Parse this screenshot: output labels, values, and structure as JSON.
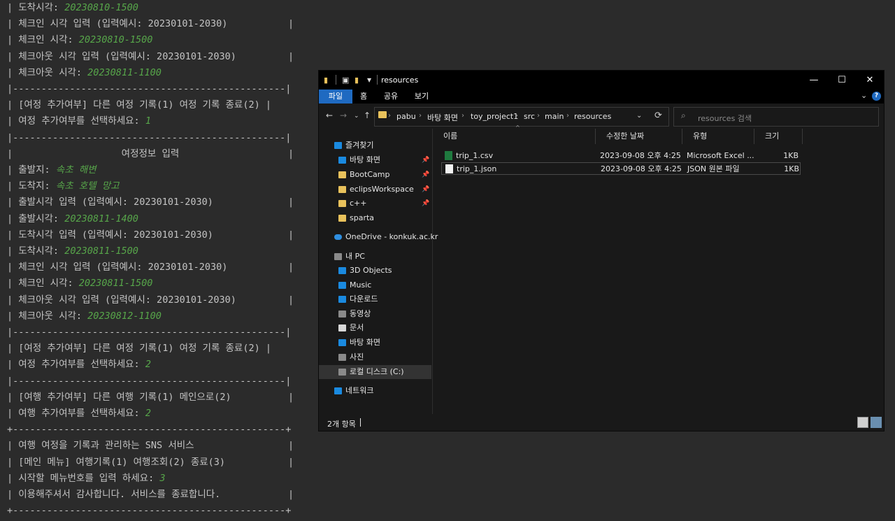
{
  "console": {
    "lines": [
      {
        "text": "| 도착시각: ",
        "input": "20230810-1500",
        "border": false
      },
      {
        "text": "| 체크인 시각 입력 (입력예시: 20230101-2030)",
        "border": true
      },
      {
        "text": "| 체크인 시각: ",
        "input": "20230810-1500",
        "border": false
      },
      {
        "text": "| 체크아웃 시각 입력 (입력예시: 20230101-2030)",
        "border": true
      },
      {
        "text": "| 체크아웃 시각: ",
        "input": "20230811-1100",
        "border": false
      },
      {
        "text": "|------------------------------------------------|",
        "border": false
      },
      {
        "text": "| [여정 추가여부] 다른 여정 기록(1) 여정 기록 종료(2) |",
        "border": false
      },
      {
        "text": "| 여정 추가여부를 선택하세요: ",
        "input": "1",
        "border": false
      },
      {
        "text": "|------------------------------------------------|",
        "border": false
      },
      {
        "text": "|",
        "center": "여정정보 입력",
        "border": true
      },
      {
        "text": "| 출발지: ",
        "input": "속초 해변",
        "border": false
      },
      {
        "text": "| 도착지: ",
        "input": "속초 호텔 망고",
        "border": false
      },
      {
        "text": "| 출발시각 입력 (입력예시: 20230101-2030)",
        "border": true
      },
      {
        "text": "| 출발시각: ",
        "input": "20230811-1400",
        "border": false
      },
      {
        "text": "| 도착시각 입력 (입력예시: 20230101-2030)",
        "border": true
      },
      {
        "text": "| 도착시각: ",
        "input": "20230811-1500",
        "border": false
      },
      {
        "text": "| 체크인 시각 입력 (입력예시: 20230101-2030)",
        "border": true
      },
      {
        "text": "| 체크인 시각: ",
        "input": "20230811-1500",
        "border": false
      },
      {
        "text": "| 체크아웃 시각 입력 (입력예시: 20230101-2030)",
        "border": true
      },
      {
        "text": "| 체크아웃 시각: ",
        "input": "20230812-1100",
        "border": false
      },
      {
        "text": "|------------------------------------------------|",
        "border": false
      },
      {
        "text": "| [여정 추가여부] 다른 여정 기록(1) 여정 기록 종료(2) |",
        "border": false
      },
      {
        "text": "| 여정 추가여부를 선택하세요: ",
        "input": "2",
        "border": false
      },
      {
        "text": "|------------------------------------------------|",
        "border": false
      },
      {
        "text": "| [여행 추가여부] 다른 여행 기록(1) 메인으로(2)",
        "border": true
      },
      {
        "text": "| 여행 추가여부를 선택하세요: ",
        "input": "2",
        "border": false
      },
      {
        "text": "+------------------------------------------------+",
        "border": false
      },
      {
        "text": "| 여행 여정을 기록과 관리하는 SNS 서비스",
        "border": true
      },
      {
        "text": "| [메인 메뉴] 여행기록(1) 여행조회(2) 종료(3)",
        "border": true
      },
      {
        "text": "| 시작할 메뉴번호를 입력 하세요: ",
        "input": "3",
        "border": false
      },
      {
        "text": "| 이용해주셔서 감사합니다. 서비스를 종료합니다.",
        "border": true
      },
      {
        "text": "+------------------------------------------------+",
        "border": false
      }
    ]
  },
  "explorer": {
    "window_title": "resources",
    "ribbon_tabs": [
      "파일",
      "홈",
      "공유",
      "보기"
    ],
    "breadcrumb": [
      "pabu",
      "바탕 화면",
      "toy_project1",
      "src",
      "main",
      "resources"
    ],
    "search_placeholder": "resources 검색",
    "nav_items": [
      {
        "label": "즐겨찾기",
        "icon": "star-icon",
        "pinned": false,
        "indent": 0
      },
      {
        "label": "바탕 화면",
        "icon": "desktop-icon",
        "pinned": true,
        "indent": 1
      },
      {
        "label": "BootCamp",
        "icon": "folder-icon",
        "pinned": true,
        "indent": 1
      },
      {
        "label": "eclipsWorkspace",
        "icon": "folder-icon",
        "pinned": true,
        "indent": 1
      },
      {
        "label": "c++",
        "icon": "folder-icon",
        "pinned": true,
        "indent": 1
      },
      {
        "label": "sparta",
        "icon": "folder-icon",
        "pinned": false,
        "indent": 1
      },
      {
        "label": "OneDrive - konkuk.ac.kr",
        "icon": "onedrive-icon",
        "pinned": false,
        "indent": 0
      },
      {
        "label": "내 PC",
        "icon": "pc-icon",
        "pinned": false,
        "indent": 0
      },
      {
        "label": "3D Objects",
        "icon": "3d-objects-icon",
        "pinned": false,
        "indent": 1
      },
      {
        "label": "Music",
        "icon": "music-icon",
        "pinned": false,
        "indent": 1
      },
      {
        "label": "다운로드",
        "icon": "download-icon",
        "pinned": false,
        "indent": 1
      },
      {
        "label": "동영상",
        "icon": "video-icon",
        "pinned": false,
        "indent": 1
      },
      {
        "label": "문서",
        "icon": "document-icon",
        "pinned": false,
        "indent": 1
      },
      {
        "label": "바탕 화면",
        "icon": "desktop-icon",
        "pinned": false,
        "indent": 1
      },
      {
        "label": "사진",
        "icon": "picture-icon",
        "pinned": false,
        "indent": 1
      },
      {
        "label": "로컬 디스크 (C:)",
        "icon": "drive-icon",
        "pinned": false,
        "indent": 1,
        "selected": true
      },
      {
        "label": "네트워크",
        "icon": "network-icon",
        "pinned": false,
        "indent": 0
      }
    ],
    "columns": [
      "이름",
      "수정한 날짜",
      "유형",
      "크기"
    ],
    "files": [
      {
        "name": "trip_1.csv",
        "modified": "2023-09-08 오후 4:25",
        "type": "Microsoft Excel ...",
        "size": "1KB",
        "icon": "excel-file-icon"
      },
      {
        "name": "trip_1.json",
        "modified": "2023-09-08 오후 4:25",
        "type": "JSON 원본 파일",
        "size": "1KB",
        "icon": "json-file-icon",
        "selected": true
      }
    ],
    "status_text": "2개 항목"
  }
}
